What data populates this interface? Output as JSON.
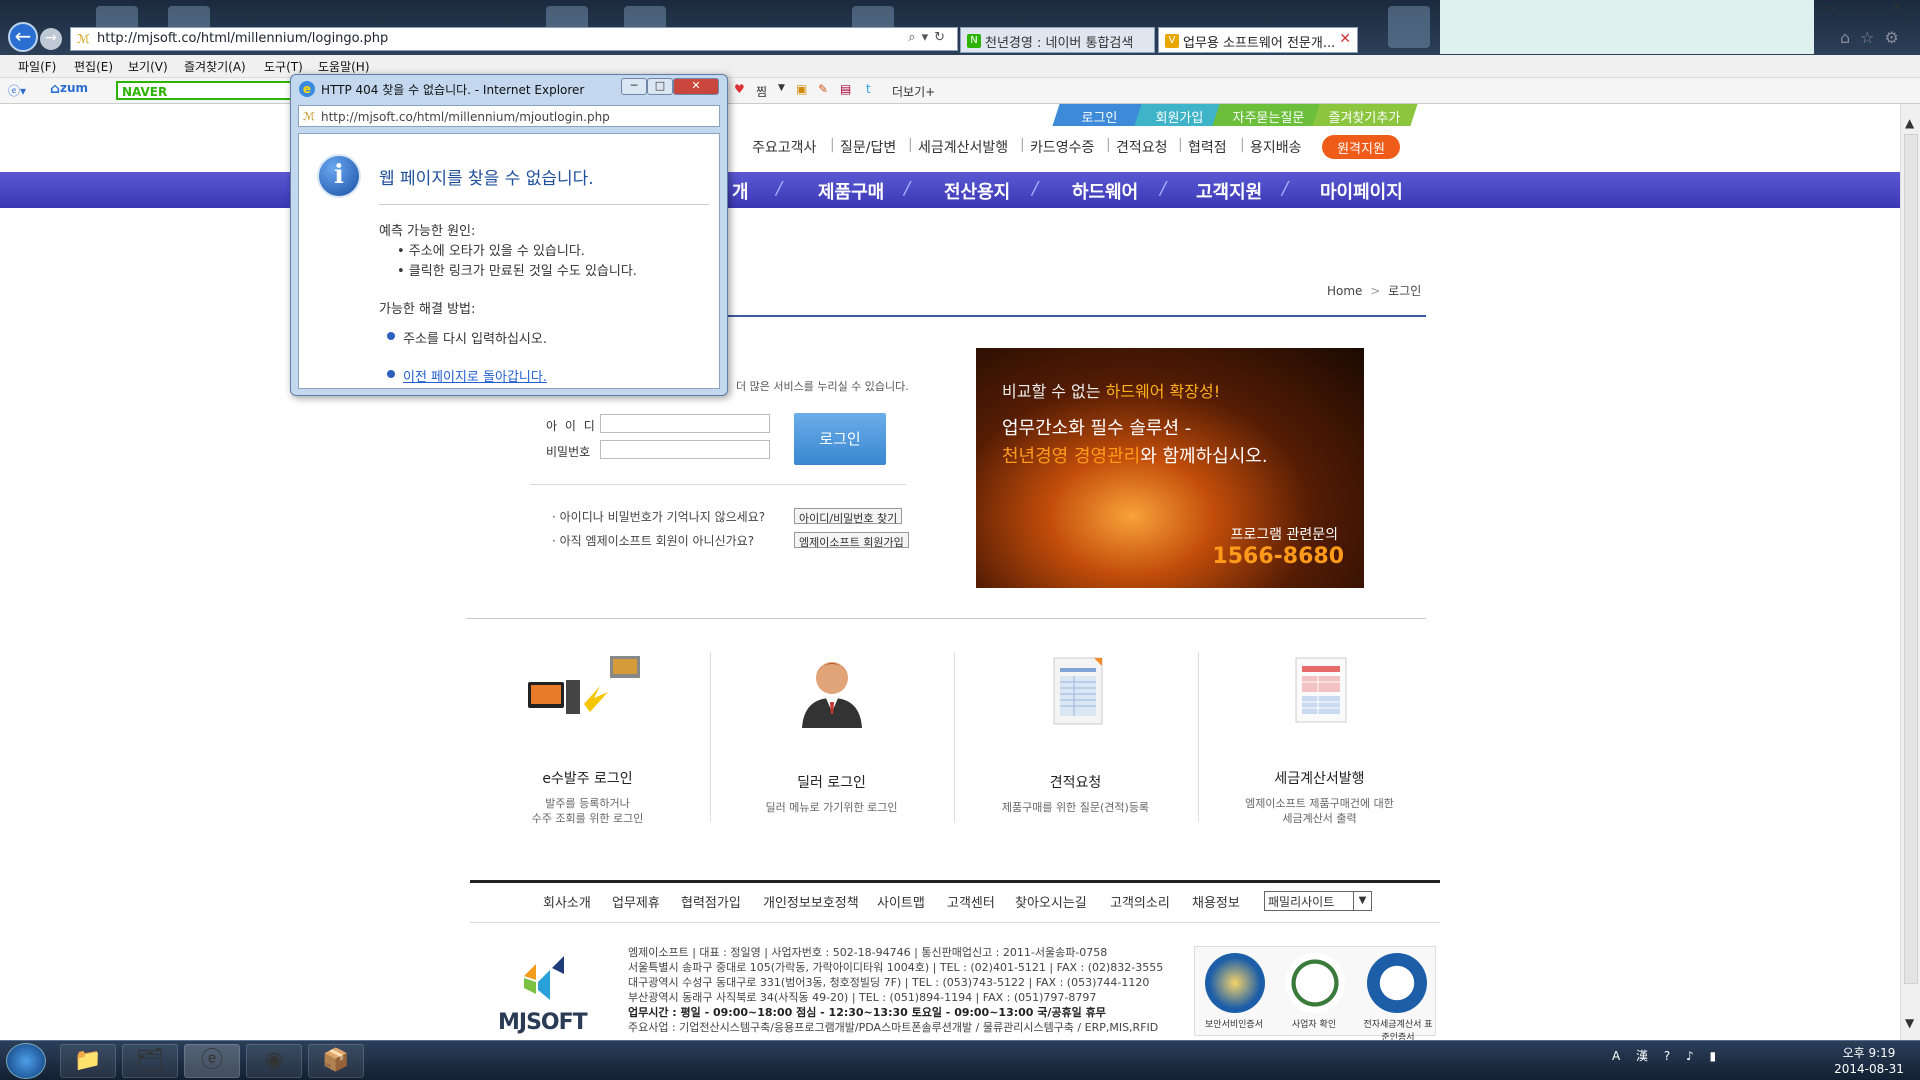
{
  "browser": {
    "address": "http://mjsoft.co/html/millennium/logingo.php",
    "tabs": [
      {
        "label": "천년경영 : 네이버 통합검색",
        "icon": "N"
      },
      {
        "label": "업무용 소프트웨어 전문개...",
        "icon": "V"
      }
    ],
    "window_controls": [
      "▭",
      "▢",
      "✕"
    ],
    "menu": [
      "파일(F)",
      "편집(E)",
      "보기(V)",
      "즐겨찾기(A)",
      "도구(T)",
      "도움말(H)"
    ],
    "toolbar": {
      "zum": "zum",
      "naver": "NAVER",
      "jjim": "찜",
      "more": "더보기+"
    }
  },
  "site": {
    "top_links": [
      "로그인",
      "회원가입",
      "자주묻는질문",
      "즐겨찾기추가"
    ],
    "top_link_colors": [
      "#3c8ad8",
      "#3fb3c7",
      "#6bbf3a",
      "#8cc63f"
    ],
    "util_links": [
      "주요고객사",
      "질문/답변",
      "세금계산서발행",
      "카드영수증",
      "견적요청",
      "협력점",
      "용지배송"
    ],
    "remote_support": "원격지원",
    "main_nav": [
      "개",
      "제품구매",
      "전산용지",
      "하드웨어",
      "고객지원",
      "마이페이지"
    ],
    "breadcrumb": {
      "home": "Home",
      "sep": ">",
      "current": "로그인"
    },
    "login": {
      "notice": "더 많은 서비스를 누리실 수 있습니다.",
      "id_label": "아 이 디",
      "pw_label": "비밀번호",
      "button": "로그인",
      "hint1": "· 아이디나 비밀번호가 기억나지 않으세요?",
      "hint1_btn": "아이디/비밀번호 찾기",
      "hint2": "· 아직 엠제이소프트 회원이 아니신가요?",
      "hint2_btn": "엠제이소프트 회원가입"
    },
    "banner": {
      "line1_a": "비교할 수 없는 ",
      "line1_b": "하드웨어 확장성!",
      "line2": "업무간소화 필수 솔루션 -",
      "line3_a": "천년경영 경영관리",
      "line3_b": "와 함께하십시오.",
      "contact_label": "프로그램 관련문의",
      "phone": "1566-8680"
    },
    "services": [
      {
        "title": "e수발주 로그인",
        "desc1": "발주를 등록하거나",
        "desc2": "수주 조회를 위한 로그인",
        "icon": "computer-transfer-icon"
      },
      {
        "title": "딜러 로그인",
        "desc1": "딜러 메뉴로 가기위한 로그인",
        "desc2": "",
        "icon": "dealer-person-icon"
      },
      {
        "title": "견적요청",
        "desc1": "제품구매를 위한 질문(견적)등록",
        "desc2": "",
        "icon": "estimate-document-icon"
      },
      {
        "title": "세금계산서발행",
        "desc1": "엠제이소프트 제품구매건에 대한",
        "desc2": "세금계산서 출력",
        "icon": "tax-invoice-icon"
      }
    ],
    "footer_nav": [
      "회사소개",
      "업무제휴",
      "협력점가입",
      "개인정보보호정책",
      "사이트맵",
      "고객센터",
      "찾아오시는길",
      "고객의소리",
      "채용정보"
    ],
    "family_site": "패밀리사이트",
    "logo": "MJSOFT",
    "footer_info": [
      "엠제이소프트 | 대표 : 정일영 | 사업자번호 : 502-18-94746 | 통신판매업신고 : 2011-서울송파-0758",
      "서울특별시 송파구 중대로 105(가락동, 가락아이디타워 1004호) | TEL : (02)401-5121 | FAX : (02)832-3555",
      "대구광역시 수성구 동대구로 331(범어3동, 청호정빌딩 7F) | TEL : (053)743-5122 | FAX : (053)744-1120",
      "부산광역시 동래구 사직북로 34(사직동 49-20) | TEL : (051)894-1194 | FAX : (051)797-8797",
      "업무시간 : 평일 - 09:00~18:00  점심 - 12:30~13:30  토요일 - 09:00~13:00  국/공휴일 휴무",
      "주요사업 : 기업전산시스템구축/응용프로그램개발/PDA스마트폰솔루션개발 / 물류관리시스템구축 / ERP,MIS,RFID"
    ],
    "certs": [
      "보안서비인증서",
      "사업자 확인",
      "전자세금계산서 표준인증서"
    ]
  },
  "dialog": {
    "title": "HTTP 404 찾을 수 없습니다. - Internet Explorer",
    "address": "http://mjsoft.co/html/millennium/mjoutlogin.php",
    "heading": "웹 페이지를 찾을 수 없습니다.",
    "cause_title": "예측 가능한 원인:",
    "cause1": "• 주소에 오타가 있을 수 있습니다.",
    "cause2": "• 클릭한 링크가 만료된 것일 수도 있습니다.",
    "solution_title": "가능한 해결 방법:",
    "solution1": "주소를 다시 입력하십시오.",
    "solution2": "이전 페이지로 돌아갑니다."
  },
  "taskbar": {
    "clock_time": "오후 9:19",
    "clock_date": "2014-08-31",
    "tray": "A 漢 ?"
  }
}
